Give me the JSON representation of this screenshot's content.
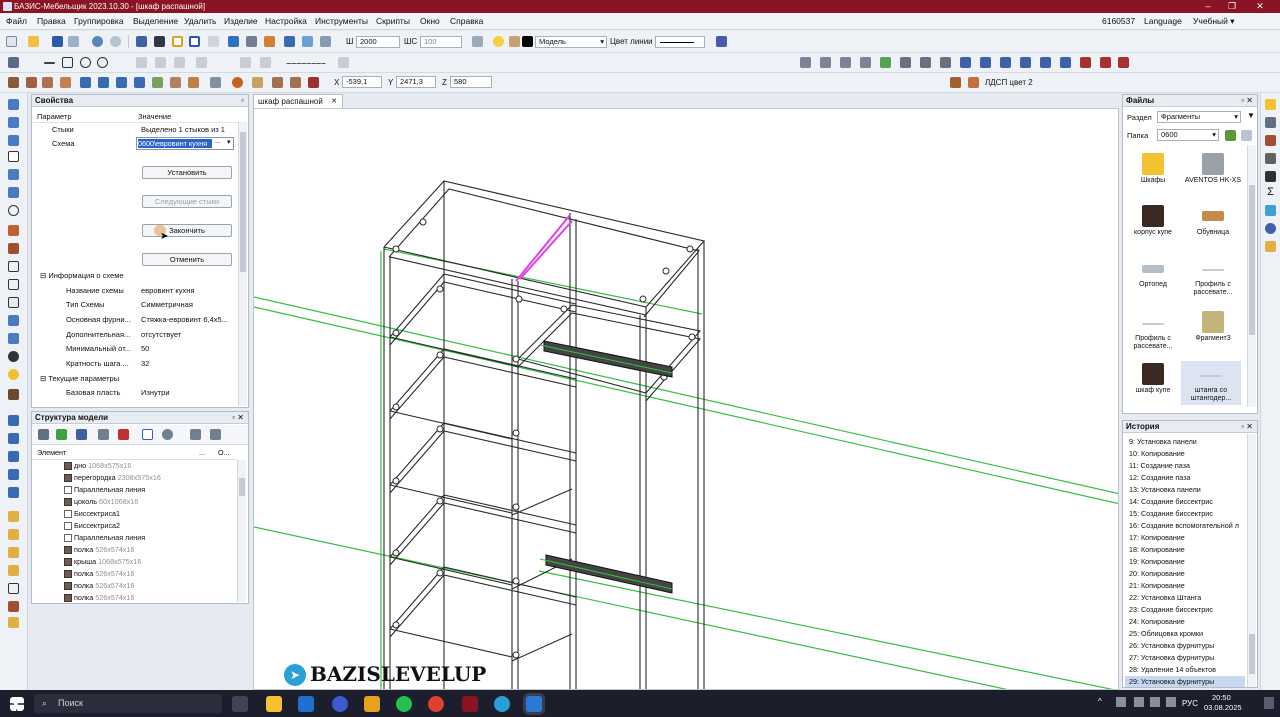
{
  "window": {
    "title": "БАЗИС-Мебельщик 2023.10.30 - [шкаф распашной]"
  },
  "menu": {
    "items": [
      "Файл",
      "Правка",
      "Группировка",
      "Выделение",
      "Удалить",
      "Изделие",
      "Настройка",
      "Инструменты",
      "Скрипты",
      "Окно",
      "Справка"
    ],
    "right": [
      "6160537",
      "Language",
      "Учебный ▾"
    ]
  },
  "toolbar": {
    "w_label": "Ш",
    "w_value": "2000",
    "shs_label": "ШС",
    "shs_value": "100",
    "layer": "Модель",
    "line_color_label": "Цвет линии"
  },
  "coords": {
    "x_label": "X",
    "x": "-539,1",
    "y_label": "Y",
    "y": "2471,3",
    "z_label": "Z",
    "z": "580"
  },
  "material": {
    "name": "ЛДСП цвет 2"
  },
  "doc_tab": {
    "label": "шкаф распашной",
    "close": "✕"
  },
  "properties": {
    "title": "Свойства",
    "pin": "▫",
    "col_param": "Параметр",
    "col_value": "Значение",
    "row_joints_label": "Стыки",
    "row_joints_value": "Выделено 1 стыков из 1",
    "row_scheme_label": "Схема",
    "row_scheme_value": "0600\\евровинт кухня",
    "scheme_btn": "...",
    "btn_install": "Установить",
    "btn_next": "Следующие стыки",
    "btn_finish": "Закончить",
    "btn_cancel": "Отменить",
    "group_info": "Информация о схеме",
    "info": [
      {
        "label": "Название схемы",
        "value": "евровинт кухня"
      },
      {
        "label": "Тип Схемы",
        "value": "Симметричная"
      },
      {
        "label": "Основная фурни...",
        "value": "Стяжка-евровинт 6,4х5..."
      },
      {
        "label": "Дополнительная...",
        "value": "отсутствует"
      },
      {
        "label": "Минимальный от...",
        "value": "50"
      },
      {
        "label": "Кратность шага ...",
        "value": "32"
      }
    ],
    "group_current": "Текущие параметры",
    "current": [
      {
        "label": "Базовая пласть",
        "value": "Изнутри"
      }
    ]
  },
  "structure": {
    "title": "Структура модели",
    "pin": "▫ ✕",
    "col_element": "Элемент",
    "col_dots": "...",
    "col_o": "О...",
    "items": [
      {
        "name": "дно",
        "size": "1068x575x16"
      },
      {
        "name": "перегородка",
        "size": "2308x575x16"
      },
      {
        "name": "Параллельная линия",
        "size": ""
      },
      {
        "name": "цоколь",
        "size": "60x1068x16"
      },
      {
        "name": "Биссектриса1",
        "size": ""
      },
      {
        "name": "Биссектриса2",
        "size": ""
      },
      {
        "name": "Параллельная линия",
        "size": ""
      },
      {
        "name": "полка",
        "size": "526x574x16"
      },
      {
        "name": "крыша",
        "size": "1068x575x16"
      },
      {
        "name": "полка",
        "size": "526x574x16"
      },
      {
        "name": "полка",
        "size": "526x574x16"
      },
      {
        "name": "полка",
        "size": "526x574x16"
      }
    ]
  },
  "files": {
    "title": "Файлы",
    "pin": "▫ ✕",
    "section_label": "Раздел",
    "section_value": "Фрагменты",
    "folder_label": "Папка",
    "folder_value": "0600",
    "tiles": [
      {
        "label": "Шкафы",
        "color": "#f2c230"
      },
      {
        "label": "AVENTOS HK-XS",
        "color": "#9aa0a8"
      },
      {
        "label": "корпус купе",
        "color": "#3a2a22"
      },
      {
        "label": "Обувница",
        "color": "#c8894a"
      },
      {
        "label": "Ортопед",
        "color": "#b8bec8"
      },
      {
        "label": "Профиль с рассевате...",
        "color": "#c9ccd2"
      },
      {
        "label": "Профиль с рассевате...",
        "color": "#c9ccd2"
      },
      {
        "label": "Фрагмент3",
        "color": "#c4b47a"
      },
      {
        "label": "шкаф купе",
        "color": "#3a2a22"
      },
      {
        "label": "штанга со штангодер...",
        "color": "#c9ccd2"
      }
    ]
  },
  "history": {
    "title": "История",
    "pin": "▫ ✕",
    "items": [
      {
        "n": "9:",
        "t": "Установка панели"
      },
      {
        "n": "10:",
        "t": "Копирование"
      },
      {
        "n": "11:",
        "t": "Создание паза"
      },
      {
        "n": "12:",
        "t": "Создание паза"
      },
      {
        "n": "13:",
        "t": "Установка панели"
      },
      {
        "n": "14:",
        "t": "Создание биссектрис"
      },
      {
        "n": "15:",
        "t": "Создание биссектрис"
      },
      {
        "n": "16:",
        "t": "Создание вспомогательной л"
      },
      {
        "n": "17:",
        "t": "Копирование"
      },
      {
        "n": "18:",
        "t": "Копирование"
      },
      {
        "n": "19:",
        "t": "Копирование"
      },
      {
        "n": "20:",
        "t": "Копирование"
      },
      {
        "n": "21:",
        "t": "Копирование"
      },
      {
        "n": "22:",
        "t": "Установка Штанга"
      },
      {
        "n": "23:",
        "t": "Создание биссектрис"
      },
      {
        "n": "24:",
        "t": "Копирование"
      },
      {
        "n": "25:",
        "t": "Облицовка кромки"
      },
      {
        "n": "26:",
        "t": "Установка фурнитуры"
      },
      {
        "n": "27:",
        "t": "Установка фурнитуры"
      },
      {
        "n": "28:",
        "t": "Удаление 14 объектов"
      },
      {
        "n": "29:",
        "t": "Установка фурнитуры"
      }
    ]
  },
  "watermark": {
    "text": "BAZISLEVELUP"
  },
  "taskbar": {
    "search": "Поиск",
    "lang": "РУС",
    "time": "20:50",
    "date": "03.08.2025"
  },
  "colors": {
    "titlebar": "#8a1424",
    "wire": "#2a2a2a",
    "guide": "#34c040",
    "rod": "#e040e8",
    "taskbar": "#1d1e2c"
  }
}
